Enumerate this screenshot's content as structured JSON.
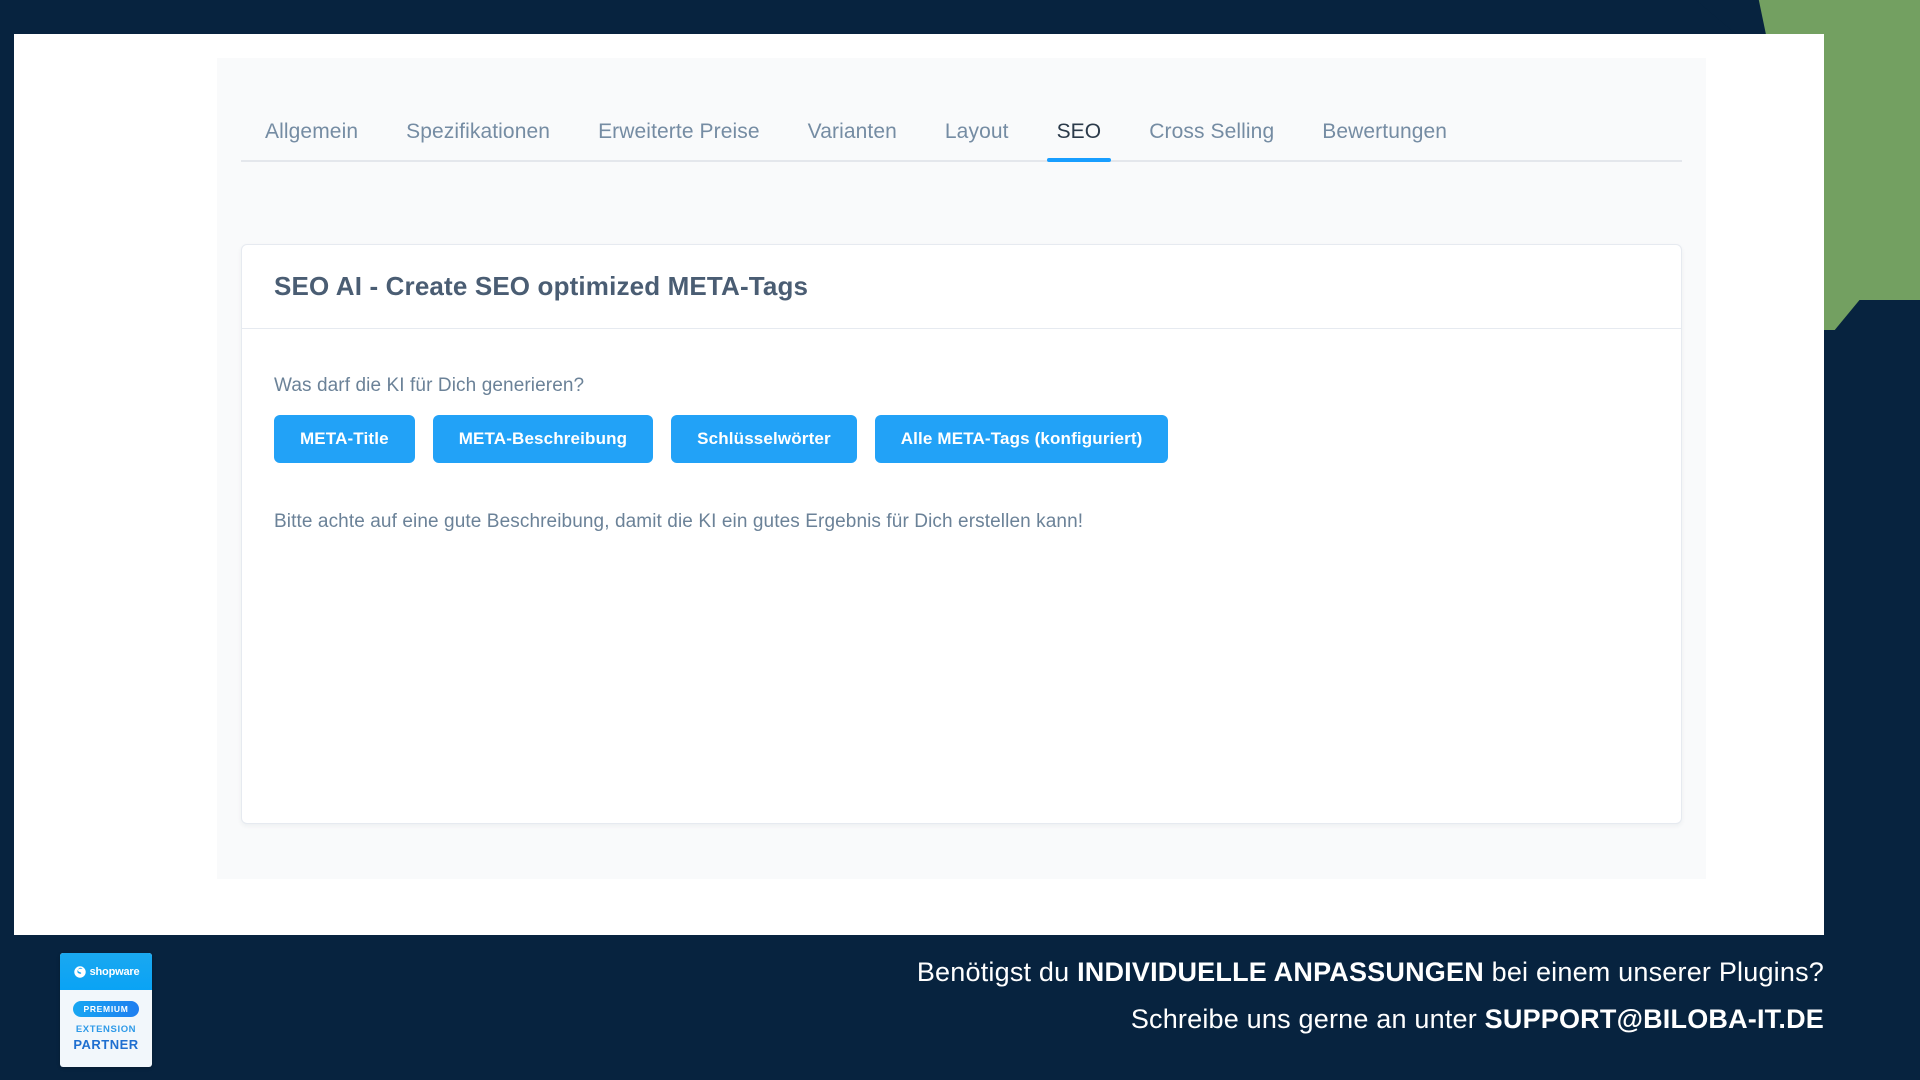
{
  "window": {
    "background_navy": "#07233f",
    "accent_green": "#73a061",
    "accent_blue": "#189eff",
    "button_blue": "#22a2f7"
  },
  "tabs": {
    "items": [
      {
        "label": "Allgemein",
        "active": false
      },
      {
        "label": "Spezifikationen",
        "active": false
      },
      {
        "label": "Erweiterte Preise",
        "active": false
      },
      {
        "label": "Varianten",
        "active": false
      },
      {
        "label": "Layout",
        "active": false
      },
      {
        "label": "SEO",
        "active": true
      },
      {
        "label": "Cross Selling",
        "active": false
      },
      {
        "label": "Bewertungen",
        "active": false
      }
    ]
  },
  "card": {
    "title": "SEO AI - Create SEO optimized META-Tags",
    "prompt_label": "Was darf die KI für Dich generieren?",
    "buttons": [
      {
        "label": "META-Title"
      },
      {
        "label": "META-Beschreibung"
      },
      {
        "label": "Schlüsselwörter"
      },
      {
        "label": "Alle META-Tags (konfiguriert)"
      }
    ],
    "hint": "Bitte achte auf eine gute Beschreibung, damit die KI ein gutes Ergebnis für Dich erstellen kann!"
  },
  "footer": {
    "line1_prefix": "Benötigst du ",
    "line1_bold": "INDIVIDUELLE ANPASSUNGEN",
    "line1_suffix": " bei einem unserer Plugins?",
    "line2_prefix": "Schreibe uns gerne an unter ",
    "line2_bold": "SUPPORT@BILOBA-IT.DE",
    "badge": {
      "wordmark": "shopware",
      "premium": "PREMIUM",
      "extension": "EXTENSION",
      "partner": "PARTNER"
    }
  }
}
